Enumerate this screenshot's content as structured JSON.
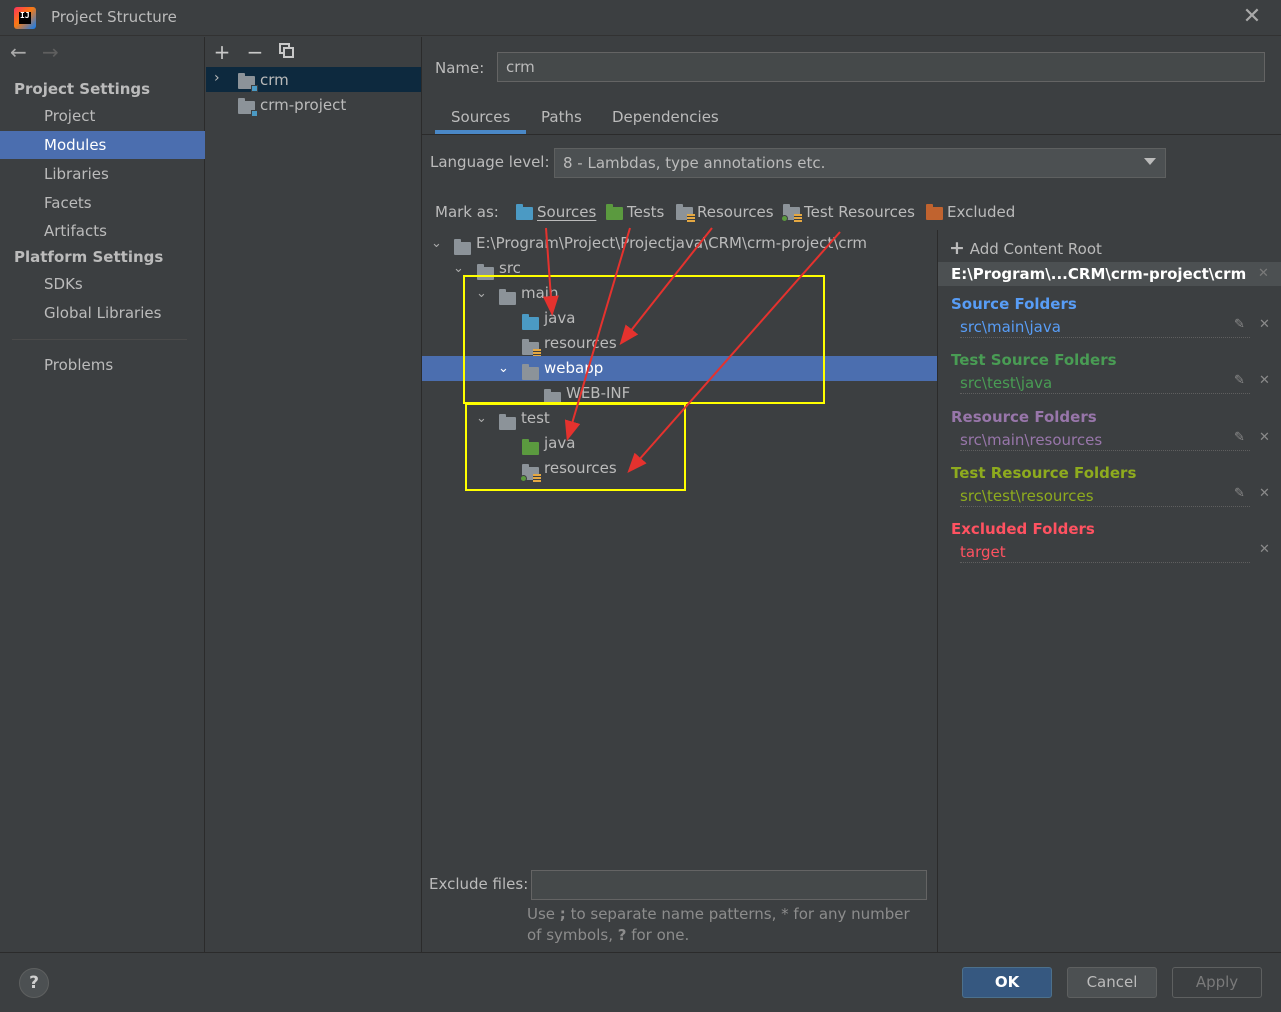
{
  "window": {
    "title": "Project Structure"
  },
  "nav": {
    "project_settings_header": "Project Settings",
    "project_settings": [
      "Project",
      "Modules",
      "Libraries",
      "Facets",
      "Artifacts"
    ],
    "platform_settings_header": "Platform Settings",
    "platform_settings": [
      "SDKs",
      "Global Libraries"
    ],
    "problems": "Problems",
    "selected": "Modules"
  },
  "modules": {
    "items": [
      "crm",
      "crm-project"
    ],
    "selected": "crm"
  },
  "details": {
    "name_label": "Name:",
    "name_value": "crm",
    "tabs": [
      "Sources",
      "Paths",
      "Dependencies"
    ],
    "active_tab": "Sources",
    "language_level_label": "Language level:",
    "language_level_value": "8 - Lambdas, type annotations etc.",
    "mark_as_label": "Mark as:",
    "mark_as": [
      "Sources",
      "Tests",
      "Resources",
      "Test Resources",
      "Excluded"
    ]
  },
  "tree": {
    "root": "E:\\Program\\Project\\Projectjava\\CRM\\crm-project\\crm",
    "nodes": [
      "src",
      "main",
      "java",
      "resources",
      "webapp",
      "WEB-INF",
      "test",
      "java",
      "resources"
    ],
    "selected": "webapp"
  },
  "content_roots": {
    "add_label": "Add Content Root",
    "root_path": "E:\\Program\\...CRM\\crm-project\\crm",
    "groups": [
      {
        "title": "Source Folders",
        "path": "src\\main\\java",
        "color": "#589df6"
      },
      {
        "title": "Test Source Folders",
        "path": "src\\test\\java",
        "color": "#499c54"
      },
      {
        "title": "Resource Folders",
        "path": "src\\main\\resources",
        "color": "#9876aa"
      },
      {
        "title": "Test Resource Folders",
        "path": "src\\test\\resources",
        "color": "#8eab1e"
      },
      {
        "title": "Excluded Folders",
        "path": "target",
        "color": "#ff5261"
      }
    ]
  },
  "exclude": {
    "label": "Exclude files:",
    "value": "",
    "hint_1": "Use ",
    "hint_semicolon": ";",
    "hint_2": " to separate name patterns, * for any number of symbols, ",
    "hint_q": "?",
    "hint_3": " for one."
  },
  "buttons": {
    "ok": "OK",
    "cancel": "Cancel",
    "apply": "Apply",
    "help": "?"
  },
  "icons": [
    "back-arrow-icon",
    "forward-arrow-icon",
    "add-icon",
    "remove-icon",
    "copy-icon",
    "close-icon",
    "help-icon",
    "chevron-down-icon"
  ],
  "colors": {
    "selection": "#4b6eaf",
    "highlight_box": "#ffff00",
    "arrow": "#e5322e"
  }
}
